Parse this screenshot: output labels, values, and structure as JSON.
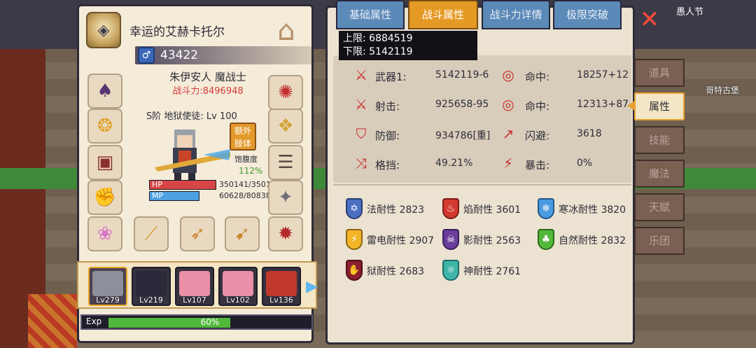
{
  "header": {
    "character_name": "幸运的艾赫卡托尔",
    "gender_power": "43422"
  },
  "character": {
    "race_class": "朱伊安人 魔战士",
    "combat_power": "战斗力:8496948",
    "rank": "S阶 地狱使徒: Lv 100",
    "extra_limb_button": "额外\n肢体",
    "extra_limb_line1": "额外",
    "extra_limb_line2": "肢体",
    "satiety_label": "饱腹度",
    "satiety_value": "112%",
    "hp_label": "HP",
    "hp_value": "350141/3501",
    "hp_fraction": 1.0,
    "mp_label": "MP",
    "mp_value": "60628/80838",
    "mp_fraction": 0.75
  },
  "party": [
    {
      "level": "Lv279",
      "active": true
    },
    {
      "level": "Lv219",
      "active": false
    },
    {
      "level": "Lv107",
      "active": false
    },
    {
      "level": "Lv102",
      "active": false
    },
    {
      "level": "Lv136",
      "active": false
    }
  ],
  "exp": {
    "label": "Exp",
    "percent": "60%",
    "fraction": 0.6
  },
  "tabs": [
    {
      "label": "基础属性",
      "active": false
    },
    {
      "label": "战斗属性",
      "active": true
    },
    {
      "label": "战斗力详情",
      "active": false
    },
    {
      "label": "极限突破",
      "active": false
    }
  ],
  "tooltip": {
    "upper": "上限: 6884519",
    "lower": "下限: 5142119"
  },
  "stats": {
    "weapon_label": "武器1:",
    "weapon_value": "5142119-6",
    "hit1_label": "命中:",
    "hit1_value": "18257+12",
    "shoot_label": "射击:",
    "shoot_value": "925658-95",
    "hit2_label": "命中:",
    "hit2_value": "12313+87",
    "defense_label": "防御:",
    "defense_value": "934786[重]",
    "dodge_label": "闪避:",
    "dodge_value": "3618",
    "block_label": "格挡:",
    "block_value": "49.21%",
    "crit_label": "暴击:",
    "crit_value": "0%"
  },
  "resistances": [
    {
      "label": "法耐性 2823",
      "color": "#4a6fc0"
    },
    {
      "label": "焰耐性 3601",
      "color": "#d23a30"
    },
    {
      "label": "寒冰耐性 3820",
      "color": "#4a9be0"
    },
    {
      "label": "雷电耐性 2907",
      "color": "#f3b428"
    },
    {
      "label": "影耐性 2563",
      "color": "#6a3d9a"
    },
    {
      "label": "自然耐性 2832",
      "color": "#52b83c"
    },
    {
      "label": "狱耐性 2683",
      "color": "#8a1f2e"
    },
    {
      "label": "神耐性 2761",
      "color": "#3fb5a8"
    }
  ],
  "sidebar": [
    {
      "label": "道具",
      "active": false
    },
    {
      "label": "属性",
      "active": true
    },
    {
      "label": "技能",
      "active": false
    },
    {
      "label": "魔法",
      "active": false
    },
    {
      "label": "天赋",
      "active": false
    },
    {
      "label": "乐团",
      "active": false
    }
  ],
  "background": {
    "event_text": "愚人节",
    "location_text": "哥特古堡"
  }
}
